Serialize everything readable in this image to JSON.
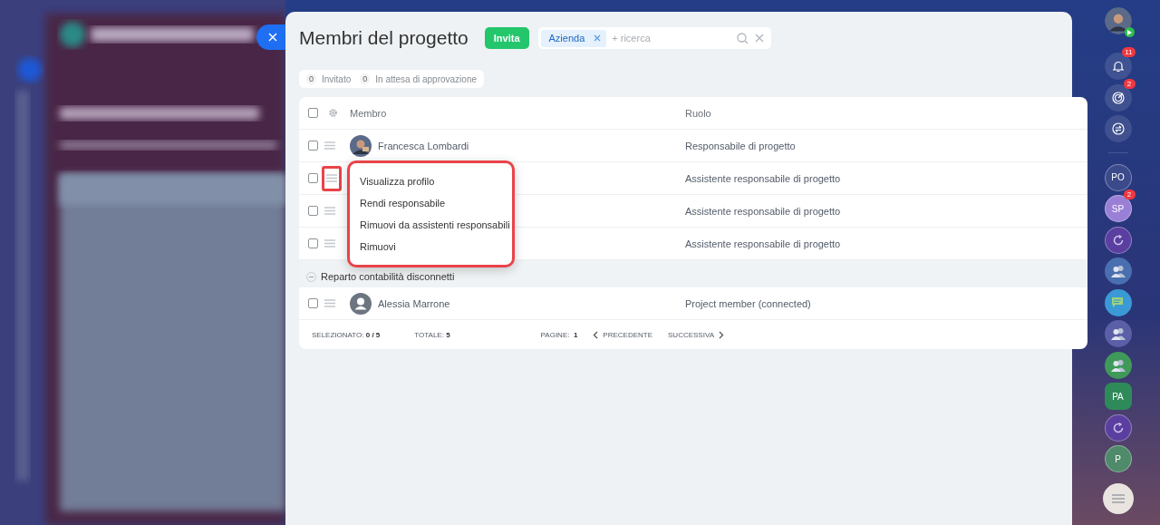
{
  "title": "Membri del progetto",
  "invite_button": "Invita",
  "filter": {
    "tags": [
      {
        "label": "Azienda"
      }
    ],
    "placeholder": "+ ricerca"
  },
  "counters": [
    {
      "count": "0",
      "label": "Invitato"
    },
    {
      "count": "0",
      "label": "In attesa di approvazione"
    }
  ],
  "table": {
    "select_all_checked": false,
    "columns": [
      "Membro",
      "Ruolo"
    ],
    "rows": [
      {
        "kind": "member",
        "checked": false,
        "highlighted": false,
        "avatar": {
          "kind": "photo"
        },
        "name": "Francesca Lombardi",
        "role": "Responsabile di progetto"
      },
      {
        "kind": "member",
        "checked": false,
        "highlighted": true,
        "role": "Assistente responsabile di progetto"
      },
      {
        "kind": "member",
        "checked": false,
        "highlighted": false,
        "role": "Assistente responsabile di progetto"
      },
      {
        "kind": "member",
        "checked": false,
        "highlighted": false,
        "role": "Assistente responsabile di progetto"
      },
      {
        "kind": "group",
        "expanded": true,
        "label": "Reparto contabilità disconnetti"
      },
      {
        "kind": "member",
        "checked": false,
        "highlighted": false,
        "avatar": {
          "kind": "placeholder"
        },
        "name": "Alessia Marrone",
        "role": "Project member (connected)"
      }
    ]
  },
  "context_menu": {
    "highlighted": true,
    "items": [
      "Visualizza profilo",
      "Rendi responsabile",
      "Rimuovi da assistenti responsabili",
      "Rimuovi"
    ]
  },
  "footer": {
    "selected_label": "SELEZIONATO:",
    "selected": "0 / 5",
    "total_label": "TOTALE:",
    "total": "5",
    "pages_label": "PAGINE:",
    "page": "1",
    "prev": "PRECEDENTE",
    "next": "SUCCESSIVA"
  },
  "right_bar": [
    {
      "kind": "user"
    },
    {
      "kind": "bell",
      "badge": "11"
    },
    {
      "kind": "target",
      "badge": "2"
    },
    {
      "kind": "swap"
    },
    {
      "kind": "divider"
    },
    {
      "kind": "initials",
      "text": "PO",
      "color": "#3b4a8a"
    },
    {
      "kind": "initials",
      "text": "SP",
      "badge": "2",
      "color": "#9a7fd6"
    },
    {
      "kind": "cycle",
      "color": "#5a3fa0"
    },
    {
      "kind": "people",
      "color": "#4a6fb0"
    },
    {
      "kind": "chat",
      "color": "#3a9ad6"
    },
    {
      "kind": "people",
      "color": "#5a5fa8"
    },
    {
      "kind": "people",
      "color": "#3f9a5a"
    },
    {
      "kind": "hex",
      "text": "PA",
      "color": "#2f8a5a"
    },
    {
      "kind": "cycle",
      "color": "#5a3fa0"
    },
    {
      "kind": "initials",
      "text": "P",
      "color": "#4f8a6a"
    },
    {
      "kind": "spacer"
    },
    {
      "kind": "menu"
    }
  ]
}
